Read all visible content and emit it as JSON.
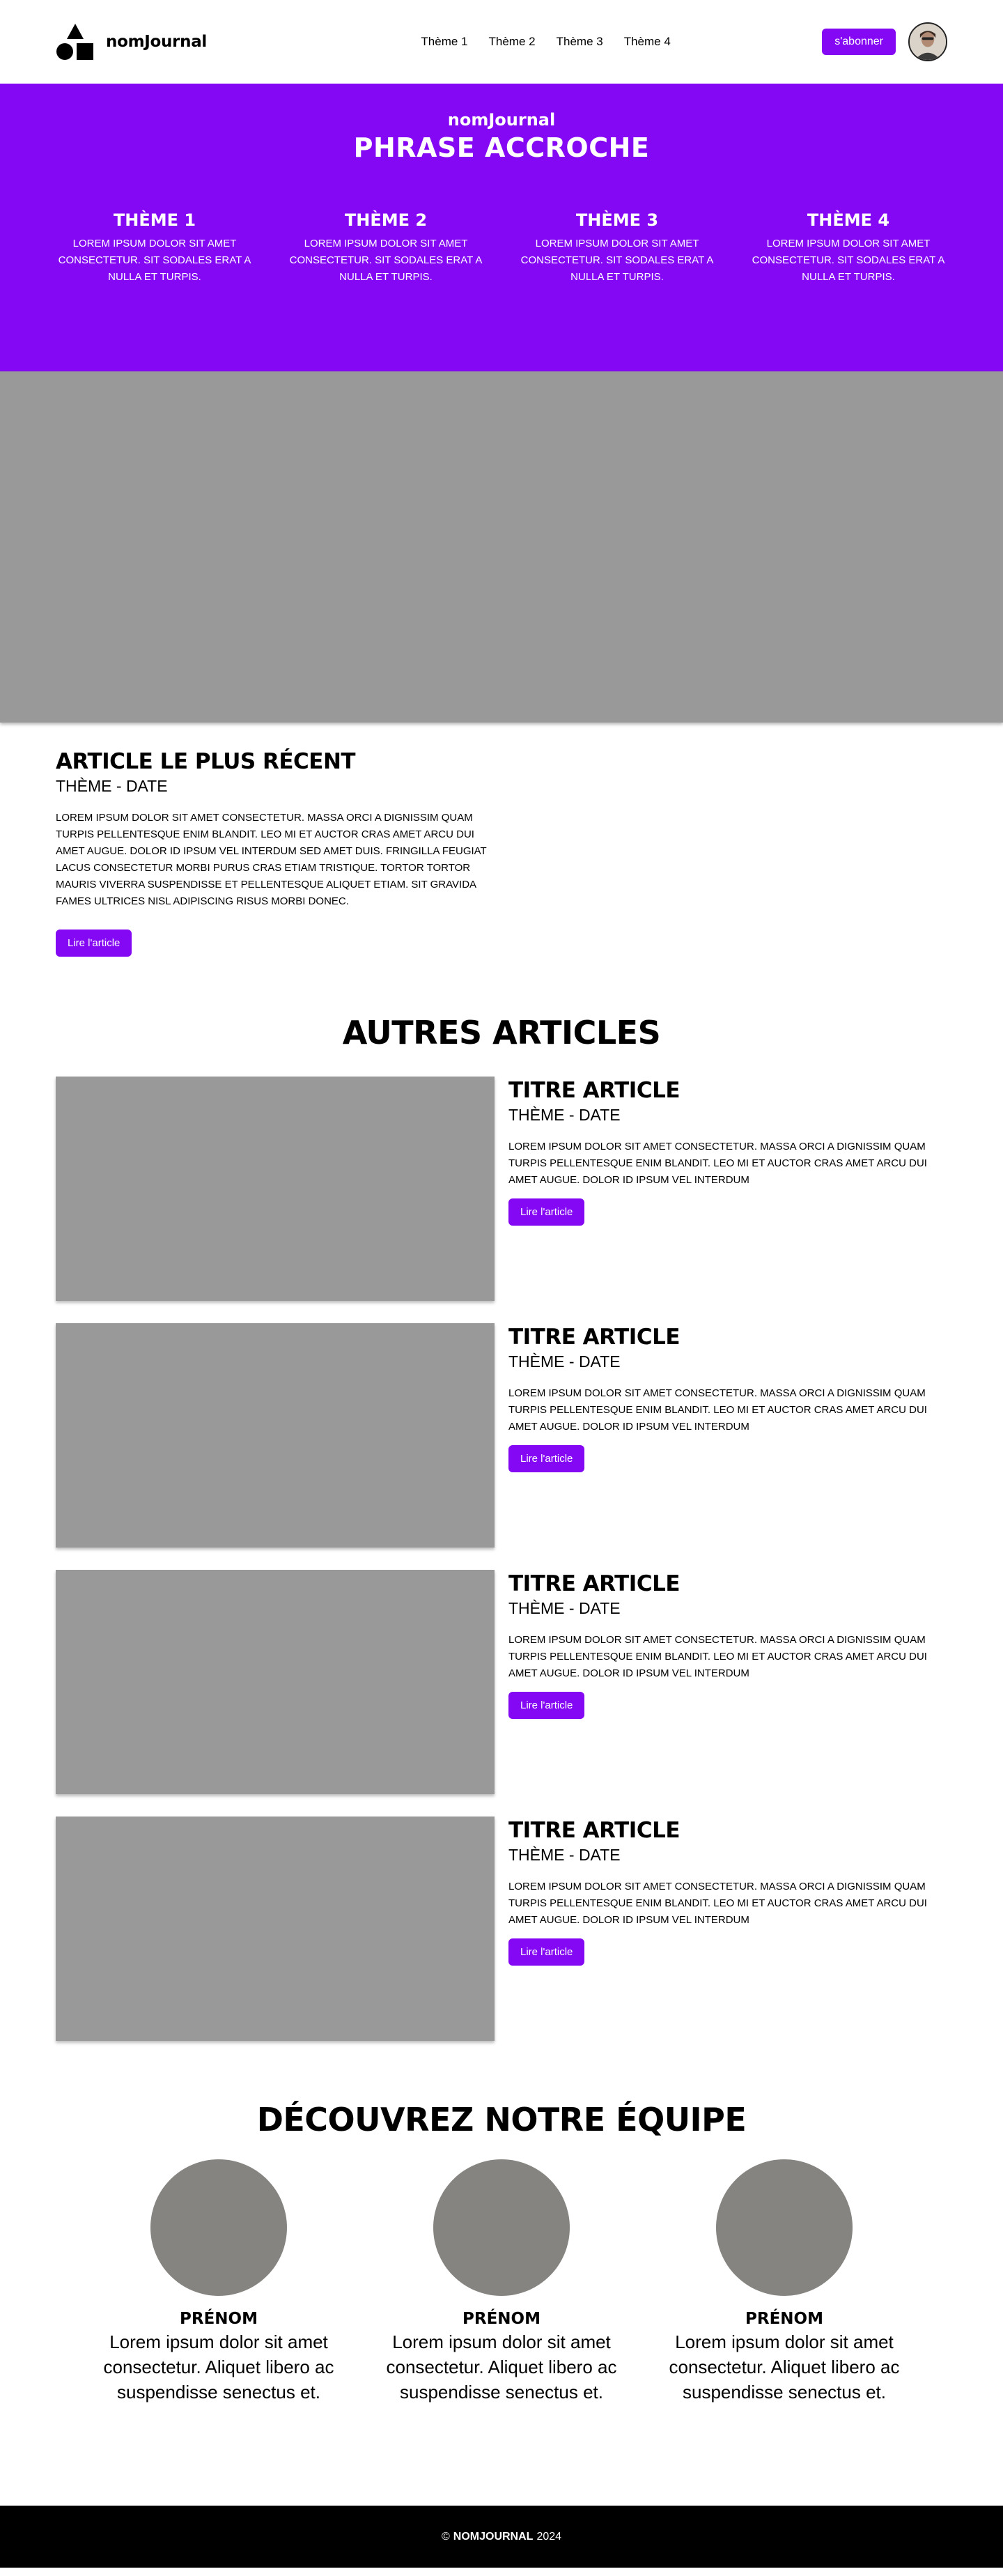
{
  "header": {
    "brand": "nomJournal",
    "nav": [
      "Thème 1",
      "Thème 2",
      "Thème 3",
      "Thème 4"
    ],
    "subscribe_label": "s'abonner"
  },
  "hero": {
    "brand": "nomJournal",
    "tagline": "PHRASE ACCROCHE",
    "themes": [
      {
        "title": "THÈME 1",
        "desc": "Lorem ipsum dolor sit amet consectetur. Sit sodales erat a nulla et turpis."
      },
      {
        "title": "THÈME 2",
        "desc": "Lorem ipsum dolor sit amet consectetur. Sit sodales erat a nulla et turpis."
      },
      {
        "title": "THÈME 3",
        "desc": "Lorem ipsum dolor sit amet consectetur. Sit sodales erat a nulla et turpis."
      },
      {
        "title": "THÈME 4",
        "desc": "Lorem ipsum dolor sit amet consectetur. Sit sodales erat a nulla et turpis."
      }
    ]
  },
  "featured": {
    "title": "Article le plus récent",
    "meta": "Thème - date",
    "text": "Lorem ipsum dolor sit amet consectetur. Massa orci a dignissim quam turpis pellentesque enim blandit. Leo mi et auctor cras amet arcu dui amet augue. Dolor id ipsum vel interdum sed amet duis. Fringilla feugiat lacus consectetur morbi purus cras etiam tristique. Tortor tortor mauris viverra suspendisse et pellentesque aliquet etiam. Sit gravida fames ultrices nisl adipiscing risus morbi donec.",
    "button": "Lire l'article"
  },
  "others": {
    "title": "AUTRES ARTICLES",
    "articles": [
      {
        "title": "Titre article",
        "meta": "Thème - date",
        "text": "Lorem ipsum dolor sit amet consectetur. Massa orci a dignissim quam turpis pellentesque enim blandit. Leo mi et auctor cras amet arcu dui amet augue. Dolor id ipsum vel interdum",
        "button": "Lire l'article"
      },
      {
        "title": "Titre article",
        "meta": "Thème - date",
        "text": "Lorem ipsum dolor sit amet consectetur. Massa orci a dignissim quam turpis pellentesque enim blandit. Leo mi et auctor cras amet arcu dui amet augue. Dolor id ipsum vel interdum",
        "button": "Lire l'article"
      },
      {
        "title": "Titre article",
        "meta": "Thème - date",
        "text": "Lorem ipsum dolor sit amet consectetur. Massa orci a dignissim quam turpis pellentesque enim blandit. Leo mi et auctor cras amet arcu dui amet augue. Dolor id ipsum vel interdum",
        "button": "Lire l'article"
      },
      {
        "title": "Titre article",
        "meta": "Thème - date",
        "text": "Lorem ipsum dolor sit amet consectetur. Massa orci a dignissim quam turpis pellentesque enim blandit. Leo mi et auctor cras amet arcu dui amet augue. Dolor id ipsum vel interdum",
        "button": "Lire l'article"
      }
    ]
  },
  "team": {
    "title": "DÉCOUVREZ NOTRE ÉQUIPE",
    "members": [
      {
        "name": "Prénom",
        "desc": "Lorem ipsum dolor sit amet consectetur. Aliquet libero ac suspendisse senectus et."
      },
      {
        "name": "Prénom",
        "desc": "Lorem ipsum dolor sit amet consectetur. Aliquet libero ac suspendisse senectus et."
      },
      {
        "name": "Prénom",
        "desc": "Lorem ipsum dolor sit amet consectetur. Aliquet libero ac suspendisse senectus et."
      }
    ]
  },
  "footer": {
    "copyright": "©",
    "brand": "nomJournal",
    "year": "2024"
  },
  "colors": {
    "accent": "#8408f3",
    "placeholder": "#999999",
    "team_photo": "#868480",
    "footer": "#000000"
  }
}
